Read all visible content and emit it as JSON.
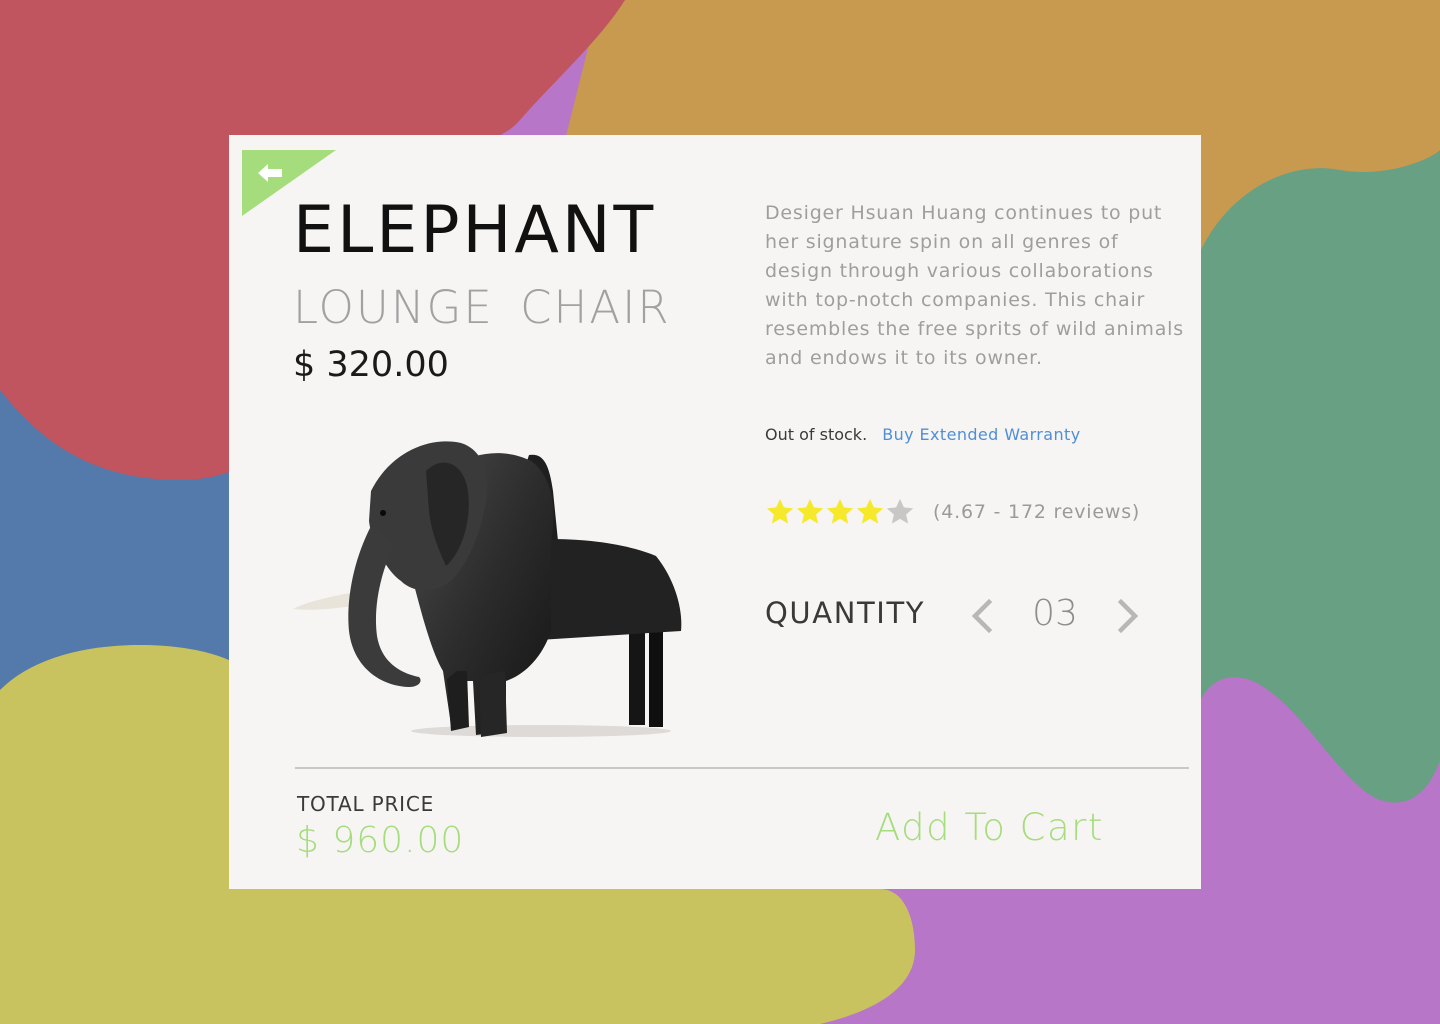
{
  "colors": {
    "accent_green": "#a5dc7c",
    "link_blue": "#4f8fd6",
    "star_filled": "#f6e92c",
    "star_empty": "#c9c7c6",
    "card_background": "#f7f5f4",
    "background_red": "#c0555f",
    "background_gold": "#c79a4f",
    "background_green": "#67a083",
    "background_blue": "#5479ab",
    "background_yellow": "#c9c35f",
    "background_purple": "#b876c9"
  },
  "back_button": {
    "icon": "arrow-left-icon"
  },
  "product": {
    "title": "ELEPHANT",
    "subtitle": "LOUNGE  CHAIR",
    "price": "$ 320.00",
    "image": "elephant-chair-image",
    "description": "Desiger Hsuan Huang continues to put her signature spin on all genres of design through various collaborations with top-notch companies. This chair resembles the free sprits of wild animals and endows it to its owner.",
    "stock_status": "Out of stock.",
    "warranty_link": "Buy Extended Warranty"
  },
  "rating": {
    "stars_total": 5,
    "stars_filled": 4,
    "text": "(4.67 - 172 reviews)"
  },
  "quantity": {
    "label": "QUANTITY",
    "value": "03",
    "prev_icon": "chevron-left-icon",
    "next_icon": "chevron-right-icon"
  },
  "cart": {
    "total_label": "TOTAL PRICE",
    "total_price": "$ 960.00",
    "add_to_cart_label": "Add To Cart"
  }
}
